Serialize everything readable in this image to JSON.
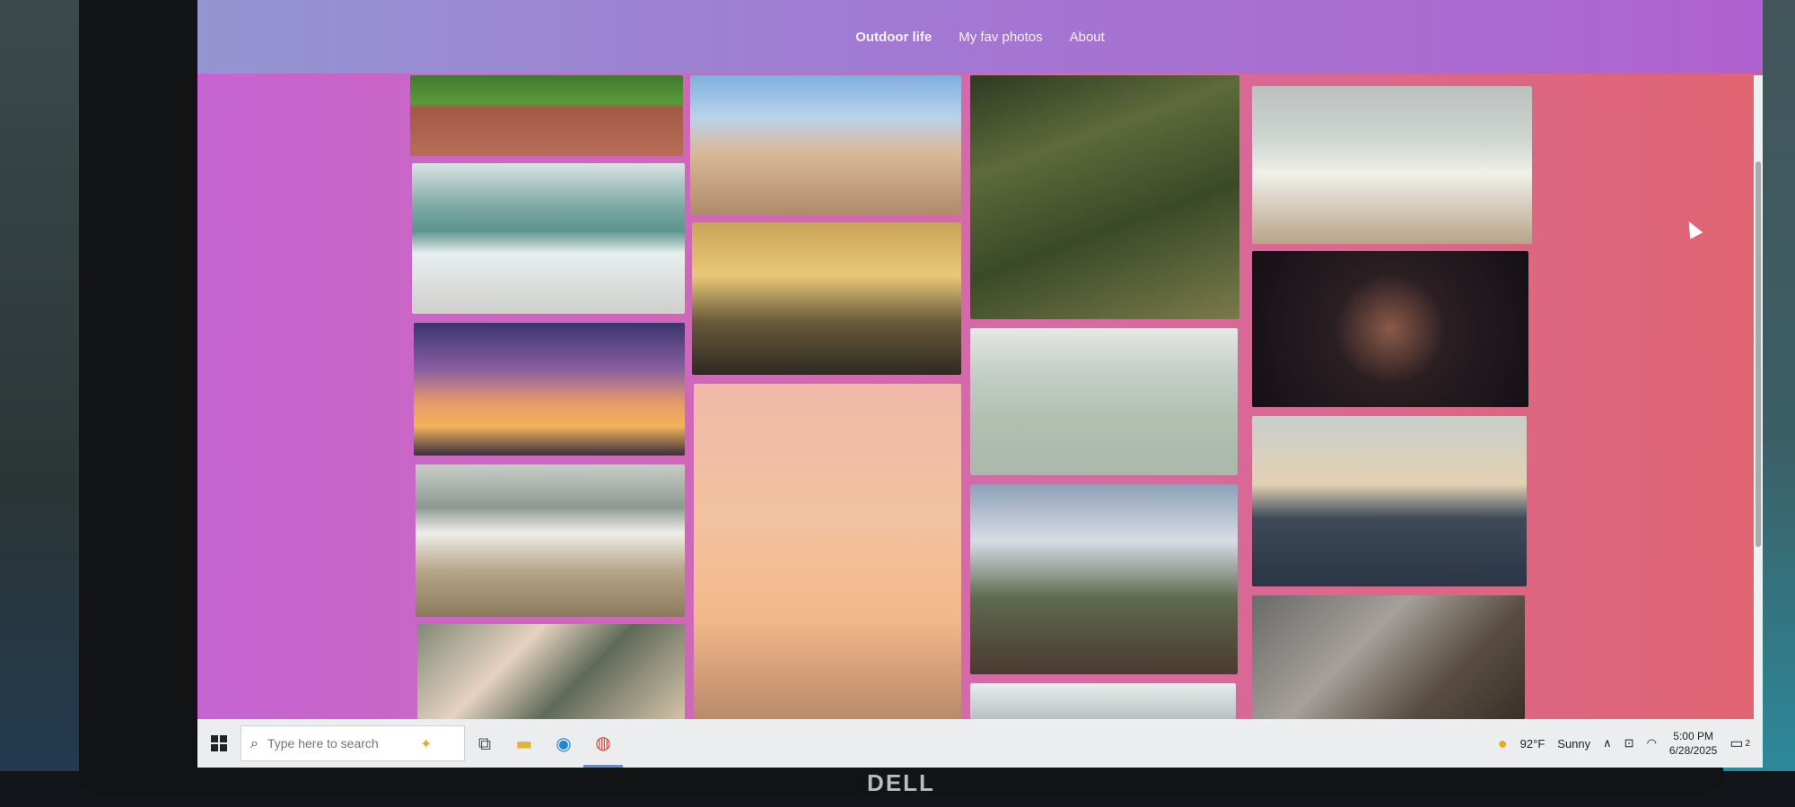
{
  "nav": {
    "items": [
      {
        "label": "Outdoor life",
        "active": true
      },
      {
        "label": "My fav photos",
        "active": false
      },
      {
        "label": "About",
        "active": false
      }
    ]
  },
  "taskbar": {
    "search_placeholder": "Type here to search",
    "weather_temp": "92°F",
    "weather_cond": "Sunny",
    "time": "5:00 PM",
    "date": "6/28/2025",
    "notif_count": "2"
  },
  "bezel": {
    "brand": "DELL"
  },
  "colors": {
    "nav_left": "#9495d1",
    "nav_right": "#b062d0",
    "page_left": "#c664d2",
    "page_right": "#e06470"
  }
}
